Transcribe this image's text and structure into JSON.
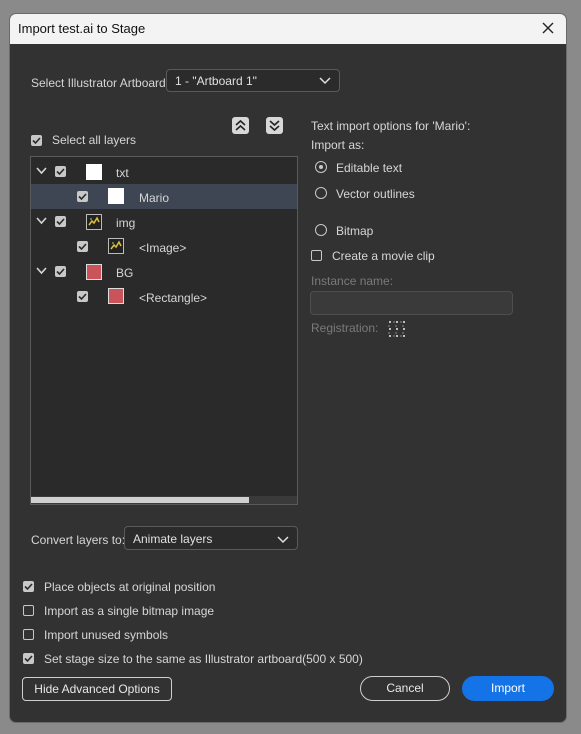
{
  "window": {
    "title": "Import test.ai to Stage"
  },
  "artboard": {
    "label": "Select Illustrator Artboard:",
    "value": "1 - \"Artboard 1\""
  },
  "select_all": {
    "label": "Select all layers",
    "checked": true
  },
  "layers": [
    {
      "name": "txt",
      "level": 0,
      "expanded": true,
      "checked": true,
      "thumb": "white"
    },
    {
      "name": "Mario",
      "level": 1,
      "checked": true,
      "thumb": "white",
      "selected": true
    },
    {
      "name": "img",
      "level": 0,
      "expanded": true,
      "checked": true,
      "thumb": "image"
    },
    {
      "name": "<Image>",
      "level": 1,
      "checked": true,
      "thumb": "image"
    },
    {
      "name": "BG",
      "level": 0,
      "expanded": true,
      "checked": true,
      "thumb": "red"
    },
    {
      "name": "<Rectangle>",
      "level": 1,
      "checked": true,
      "thumb": "red"
    }
  ],
  "text_options": {
    "heading": "Text import options for 'Mario':",
    "import_as_label": "Import as:",
    "options": [
      {
        "label": "Editable text",
        "selected": true
      },
      {
        "label": "Vector outlines",
        "selected": false
      },
      {
        "label": "Bitmap",
        "selected": false
      }
    ],
    "movie_clip": {
      "label": "Create a movie clip",
      "checked": false
    },
    "instance_name_label": "Instance name:",
    "instance_name_value": "",
    "registration_label": "Registration:"
  },
  "convert": {
    "label": "Convert layers to:",
    "value": "Animate layers"
  },
  "bottom_options": [
    {
      "label": "Place objects at original position",
      "checked": true
    },
    {
      "label": "Import as a single bitmap image",
      "checked": false
    },
    {
      "label": "Import unused symbols",
      "checked": false
    },
    {
      "label": "Set stage size to the same as Illustrator artboard(500 x 500)",
      "checked": true
    }
  ],
  "buttons": {
    "advanced": "Hide Advanced Options",
    "cancel": "Cancel",
    "import": "Import"
  },
  "colors": {
    "accent": "#1473e6",
    "selection": "#3d4652",
    "bg_swatch": "#c9545a"
  }
}
